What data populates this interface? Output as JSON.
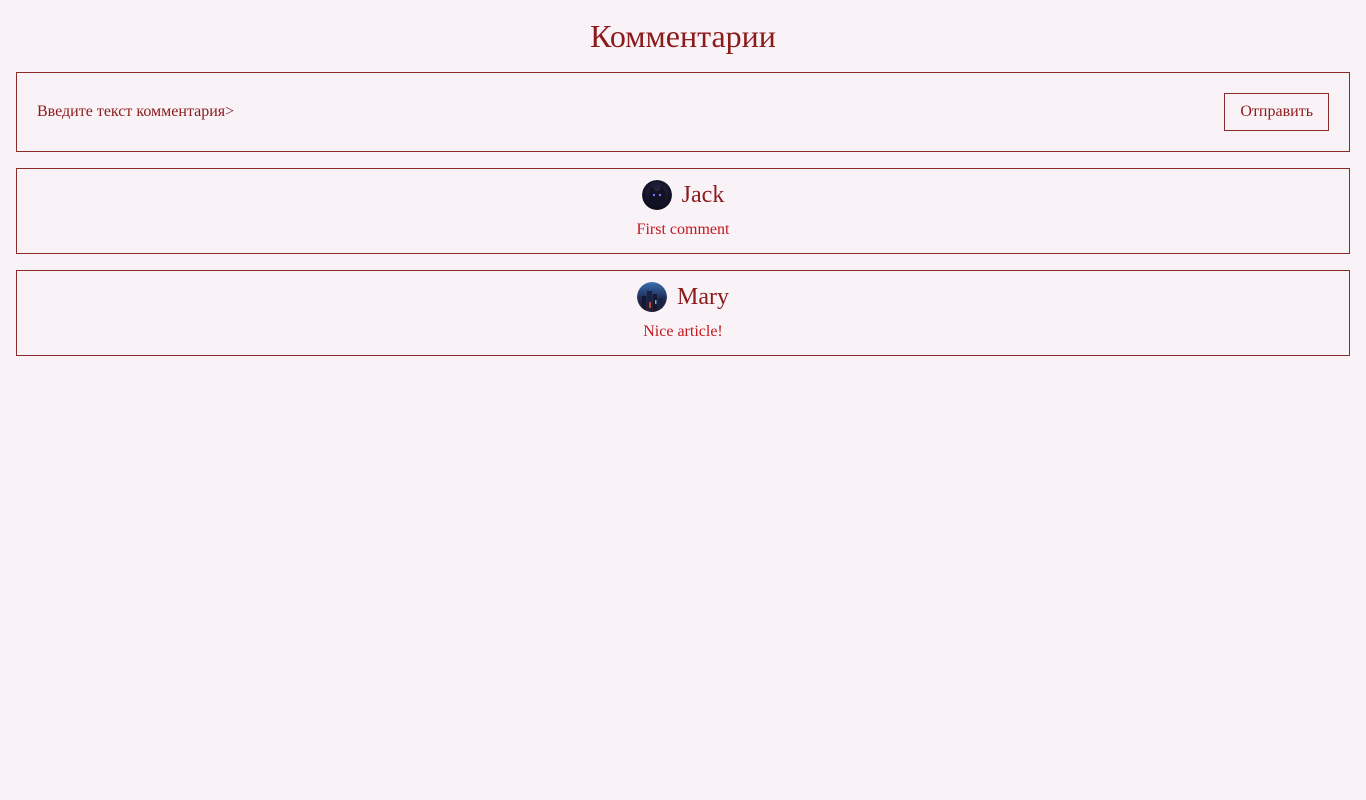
{
  "page": {
    "title": "Комментарии"
  },
  "form": {
    "input_placeholder": "Введите текст комментария>",
    "input_value": "",
    "send_label": "Отправить"
  },
  "comments": [
    {
      "author": "Jack",
      "text": "First comment",
      "avatar_icon": "avatar-dark-cat"
    },
    {
      "author": "Mary",
      "text": "Nice article!",
      "avatar_icon": "avatar-city-night"
    }
  ],
  "colors": {
    "background": "#f9f3f8",
    "title": "#8b1a1a",
    "border": "#8b2a2a",
    "comment_text": "#c0181c"
  }
}
